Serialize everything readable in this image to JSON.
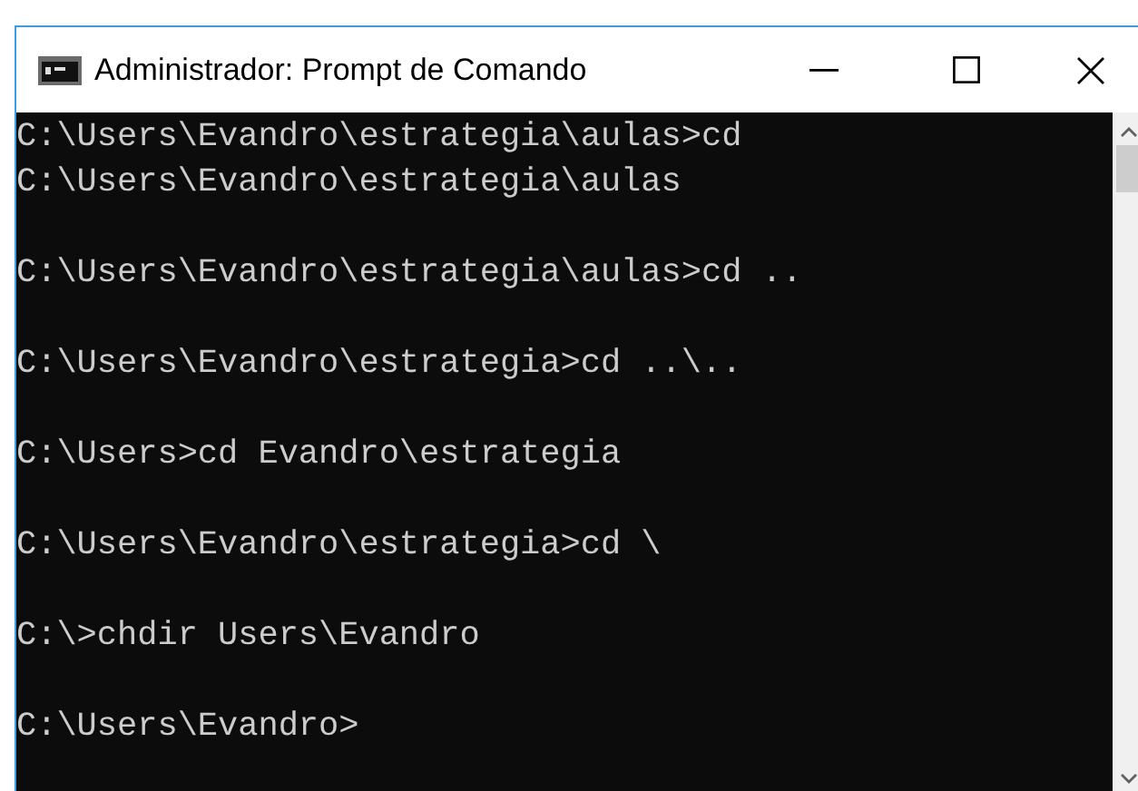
{
  "window": {
    "title": "Administrador: Prompt de Comando"
  },
  "console": {
    "lines": [
      {
        "kind": "command",
        "text": "C:\\Users\\Evandro\\estrategia\\aulas>cd"
      },
      {
        "kind": "output",
        "text": "C:\\Users\\Evandro\\estrategia\\aulas"
      },
      {
        "kind": "command",
        "text": "C:\\Users\\Evandro\\estrategia\\aulas>cd .."
      },
      {
        "kind": "command",
        "text": "C:\\Users\\Evandro\\estrategia>cd ..\\.."
      },
      {
        "kind": "command",
        "text": "C:\\Users>cd Evandro\\estrategia"
      },
      {
        "kind": "command",
        "text": "C:\\Users\\Evandro\\estrategia>cd \\"
      },
      {
        "kind": "command",
        "text": "C:\\>chdir Users\\Evandro"
      },
      {
        "kind": "prompt",
        "text": "C:\\Users\\Evandro>"
      }
    ]
  }
}
